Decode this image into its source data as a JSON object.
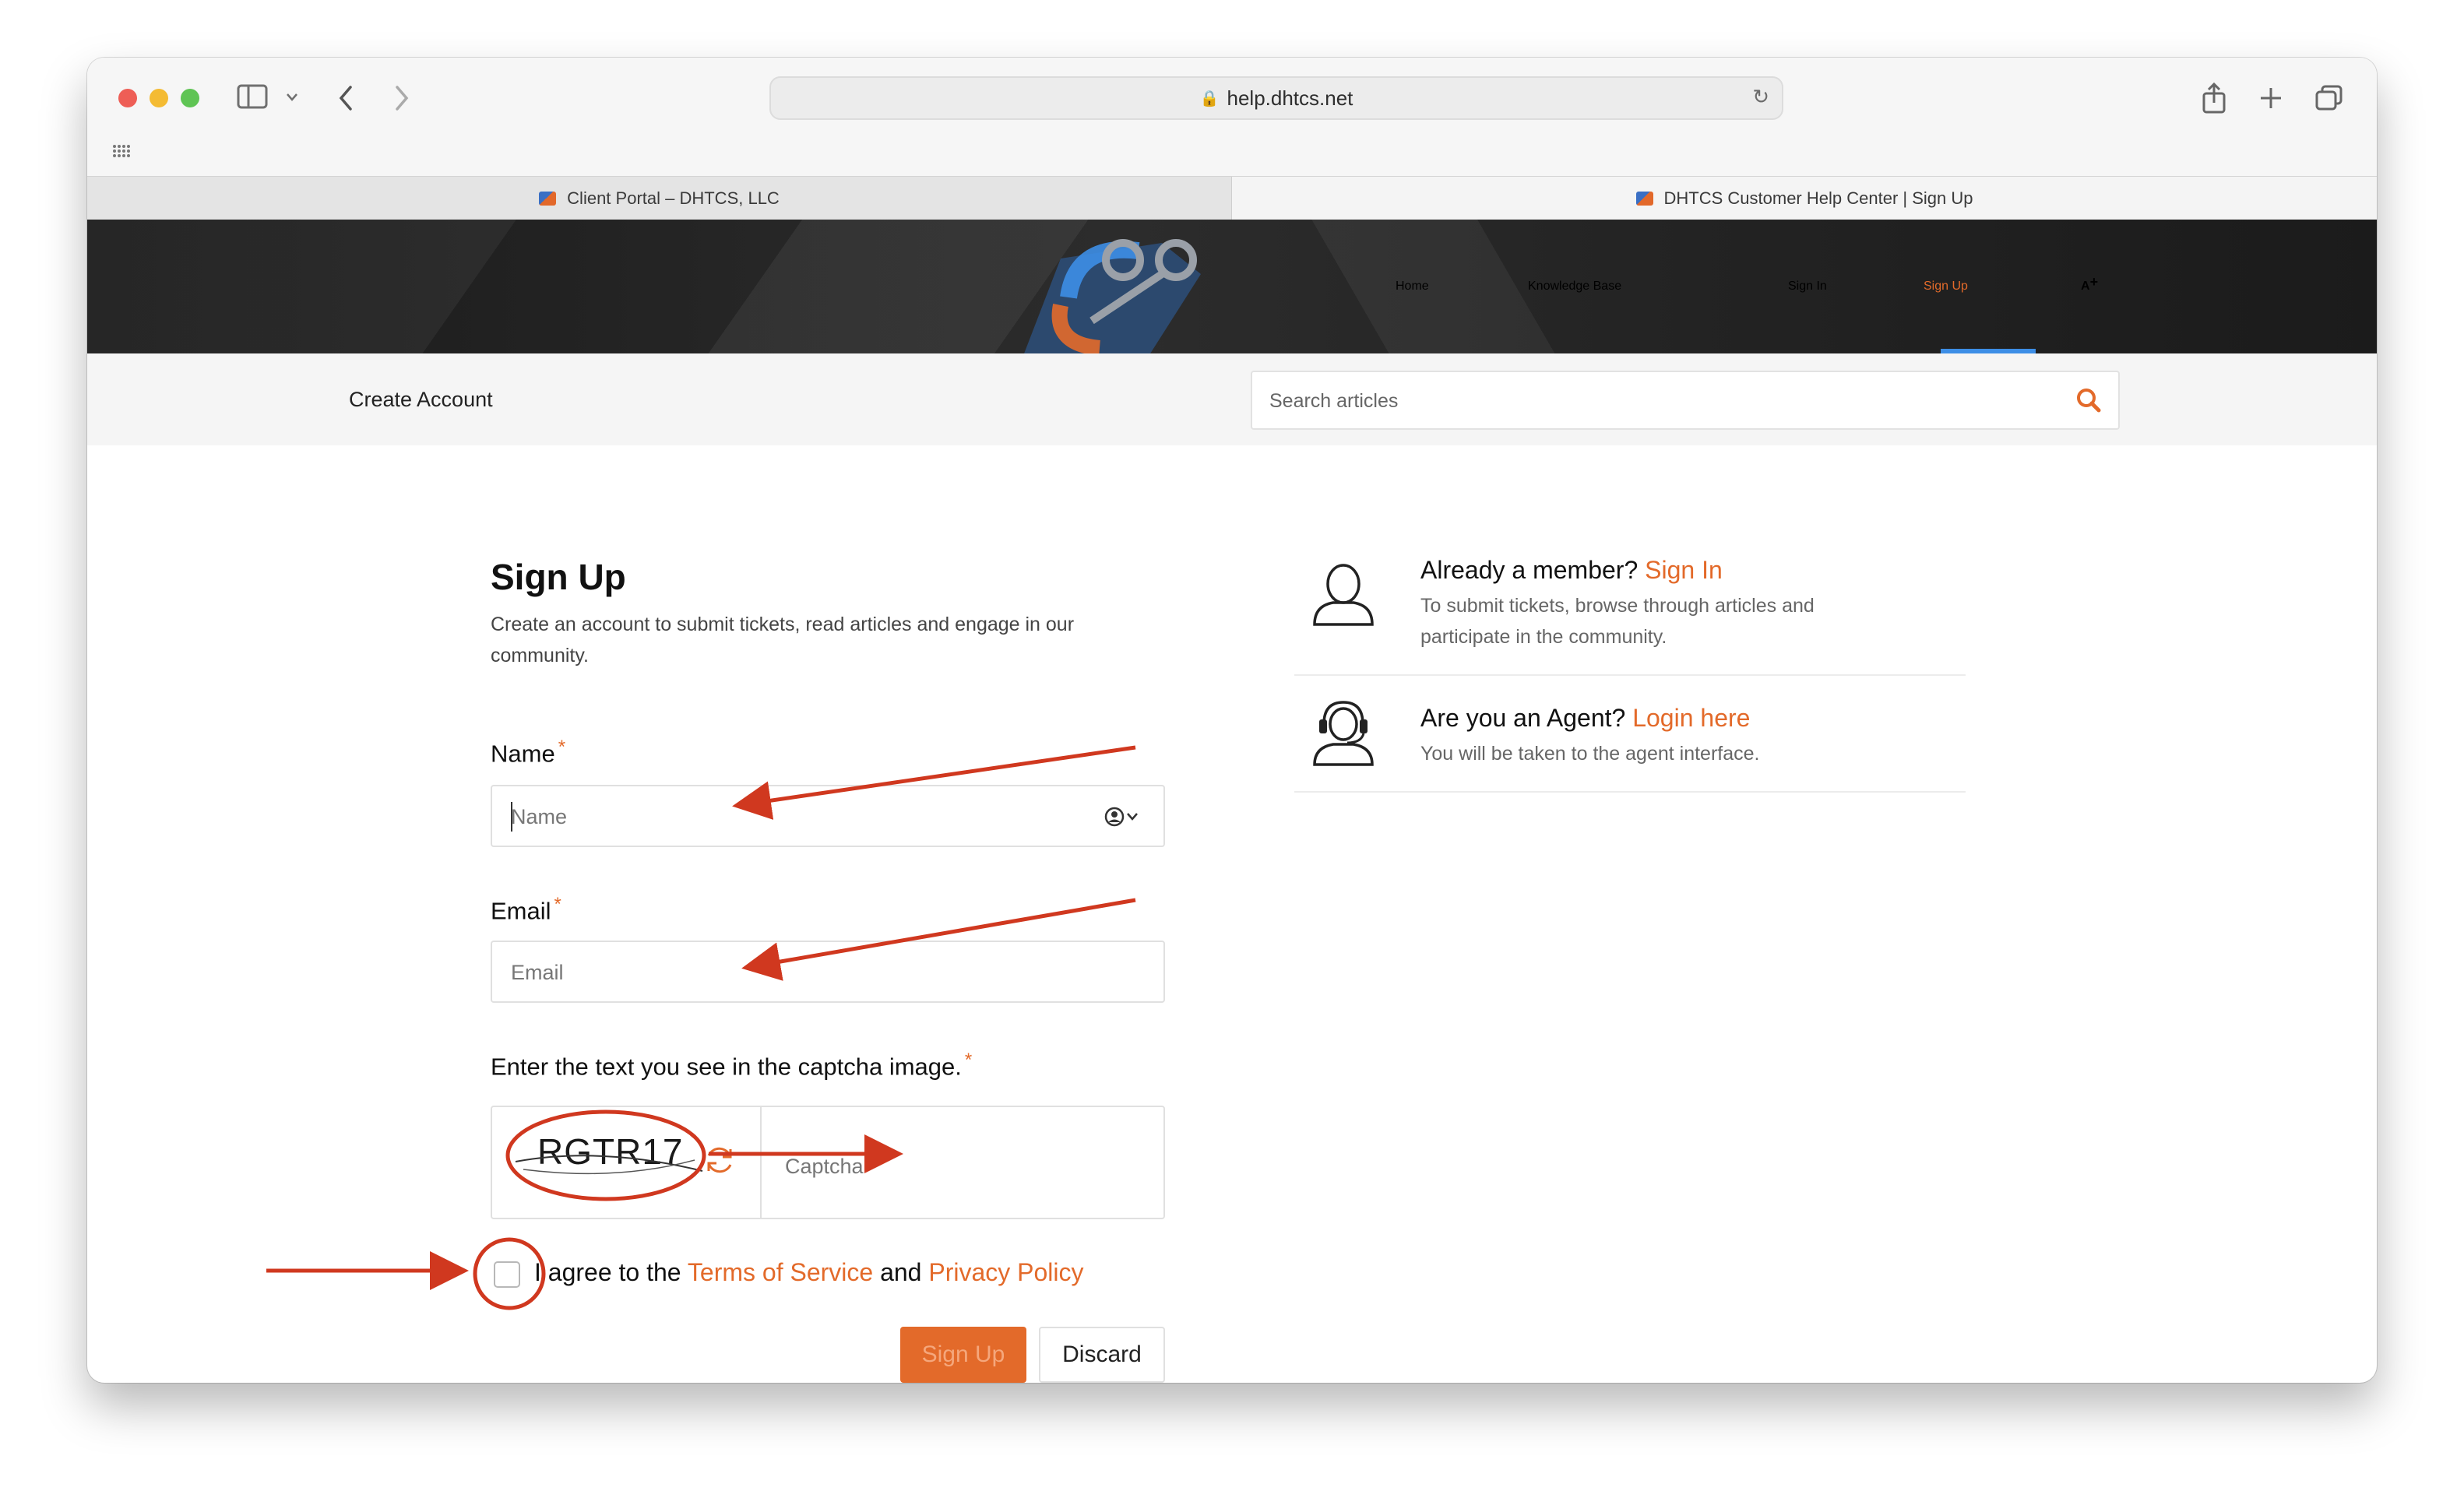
{
  "browser": {
    "url": "help.dhtcs.net",
    "tabs": [
      {
        "label": "Client Portal – DHTCS, LLC",
        "active": false
      },
      {
        "label": "DHTCS Customer Help Center | Sign Up",
        "active": true
      }
    ]
  },
  "nav": {
    "items": [
      "Home",
      "Knowledge Base",
      "Sign In",
      "Sign Up"
    ],
    "active": "Sign Up",
    "font_size_icon": "A"
  },
  "subbar": {
    "breadcrumb": "Create Account",
    "search_placeholder": "Search articles"
  },
  "form": {
    "title": "Sign Up",
    "description": "Create an account to submit tickets, read articles and engage in our community.",
    "name_label": "Name",
    "name_placeholder": "Name",
    "email_label": "Email",
    "email_placeholder": "Email",
    "captcha_label": "Enter the text you see in the captcha image.",
    "captcha_text": "RGTR17",
    "captcha_placeholder": "Captcha",
    "required_mark": "*",
    "agree_prefix": "I agree to the",
    "terms_link": "Terms of Service",
    "agree_and": "and",
    "privacy_link": "Privacy Policy",
    "signup_button": "Sign Up",
    "discard_button": "Discard"
  },
  "side_panel": {
    "member_prompt": "Already a member?",
    "member_link": "Sign In",
    "member_desc": "To submit tickets, browse through articles and participate in the community.",
    "agent_prompt": "Are you an Agent?",
    "agent_link": "Login here",
    "agent_desc": "You will be taken to the agent interface."
  },
  "colors": {
    "accent": "#e36a2a",
    "nav_underline": "#3d8ee6",
    "annotation": "#d0381f"
  }
}
